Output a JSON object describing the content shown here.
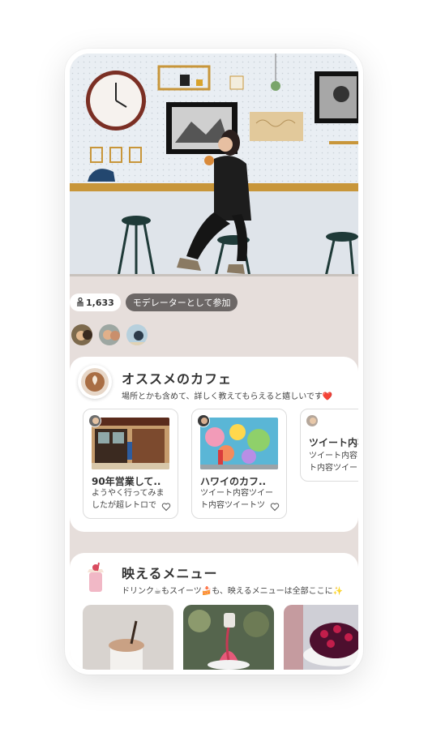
{
  "stats": {
    "member_count": "1,633",
    "moderator_label": "モデレーターとして参加"
  },
  "section_cafe": {
    "title": "オススメのカフェ",
    "description": "場所とかも含めて、詳しく教えてもらえると嬉しいです❤️",
    "cards": [
      {
        "title": "90年営業して..",
        "body": "ようやく行ってみましたが超レトロで"
      },
      {
        "title": "ハワイのカフ..",
        "body": "ツイート内容ツイート内容ツイートツ"
      },
      {
        "title": "ツイート内容",
        "body": "ツイート内容ツイート内容ツイー"
      }
    ]
  },
  "section_menu": {
    "title": "映えるメニュー",
    "description": "ドリンク☕もスイーツ🍰も、映えるメニューは全部ここに✨"
  },
  "icons": {
    "member": "person-icon",
    "heart": "heart-icon"
  },
  "colors": {
    "background": "#e6dedb",
    "moderator_pill": "#6c6766",
    "card_border": "#dcdcdc"
  }
}
